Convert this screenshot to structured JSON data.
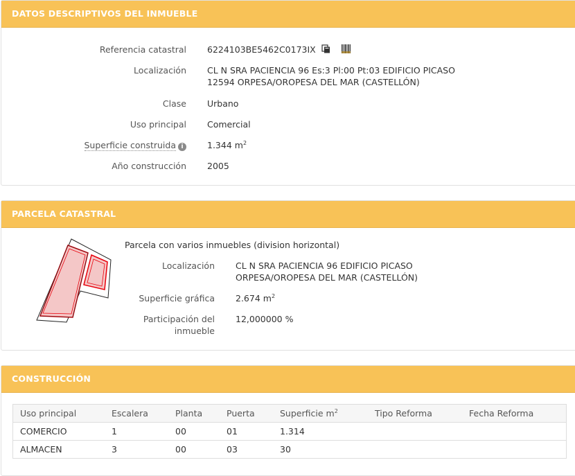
{
  "descriptivos": {
    "title": "DATOS DESCRIPTIVOS DEL INMUEBLE",
    "ref_label": "Referencia catastral",
    "ref_value": "6224103BE5462C0173IX",
    "loc_label": "Localización",
    "loc_line1": "CL N SRA PACIENCIA 96 Es:3 Pl:00 Pt:03 EDIFICIO PICASO",
    "loc_line2": "12594 ORPESA/OROPESA DEL MAR (CASTELLÓN)",
    "clase_label": "Clase",
    "clase_value": "Urbano",
    "uso_label": "Uso principal",
    "uso_value": "Comercial",
    "sup_label": "Superficie construida",
    "sup_value": "1.344 m",
    "sup_unit_exp": "2",
    "anio_label": "Año construcción",
    "anio_value": "2005"
  },
  "parcela": {
    "title": "PARCELA CATASTRAL",
    "heading": "Parcela con varios inmuebles (division horizontal)",
    "loc_label": "Localización",
    "loc_line1": "CL N SRA PACIENCIA 96 EDIFICIO PICASO",
    "loc_line2": "ORPESA/OROPESA DEL MAR (CASTELLÓN)",
    "sup_label": "Superficie gráfica",
    "sup_value": "2.674 m",
    "sup_unit_exp": "2",
    "part_label_1": "Participación del",
    "part_label_2": "inmueble",
    "part_value": "12,000000 %"
  },
  "construccion": {
    "title": "CONSTRUCCIÓN",
    "headers": {
      "uso": "Uso principal",
      "escalera": "Escalera",
      "planta": "Planta",
      "puerta": "Puerta",
      "superficie": "Superficie m",
      "superficie_exp": "2",
      "tipo": "Tipo Reforma",
      "fecha": "Fecha Reforma"
    },
    "rows": [
      {
        "uso": "COMERCIO",
        "escalera": "1",
        "planta": "00",
        "puerta": "01",
        "superficie": "1.314",
        "tipo": "",
        "fecha": ""
      },
      {
        "uso": "ALMACEN",
        "escalera": "3",
        "planta": "00",
        "puerta": "03",
        "superficie": "30",
        "tipo": "",
        "fecha": ""
      }
    ]
  },
  "icons": {
    "copy": "copy-icon",
    "barcode": "barcode-icon",
    "info": "info-icon"
  },
  "colors": {
    "header_bg": "#f8c257",
    "parcel_fill": "#f4c7c7",
    "parcel_stroke": "#e8000b"
  }
}
